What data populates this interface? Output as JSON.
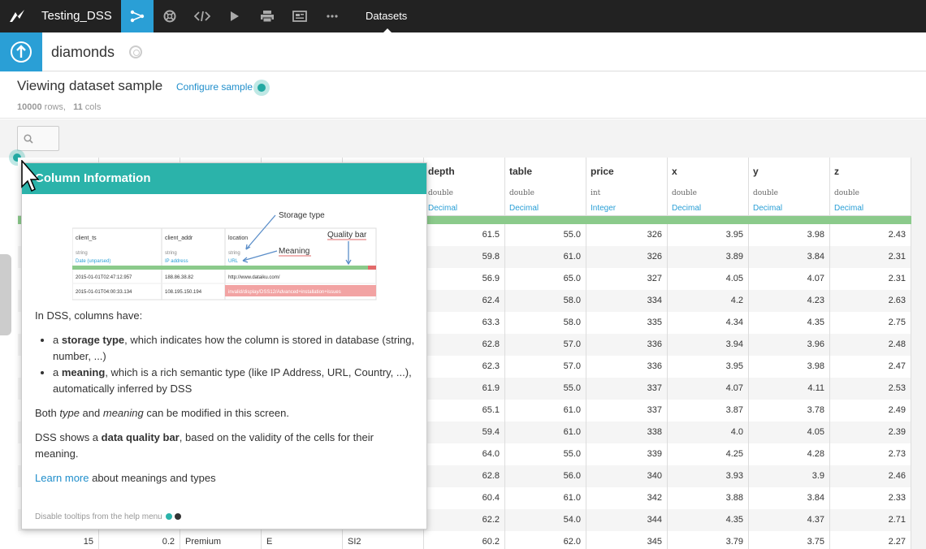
{
  "topnav": {
    "project_name": "Testing_DSS",
    "datasets_label": "Datasets",
    "icons": [
      "flow-icon",
      "lifebuoy-icon",
      "code-icon",
      "play-icon",
      "print-icon",
      "notebook-icon",
      "more-icon"
    ],
    "active_color": "#2a9fd6"
  },
  "dataset": {
    "name": "diamonds"
  },
  "view": {
    "title": "Viewing dataset sample",
    "configure_label": "Configure sample",
    "rows_count": "10000",
    "rows_suffix": " rows,",
    "cols_count": "11",
    "cols_suffix": " cols"
  },
  "columns": [
    {
      "name": "depth",
      "type": "double",
      "meaning": "Decimal"
    },
    {
      "name": "table",
      "type": "double",
      "meaning": "Decimal"
    },
    {
      "name": "price",
      "type": "int",
      "meaning": "Integer"
    },
    {
      "name": "x",
      "type": "double",
      "meaning": "Decimal"
    },
    {
      "name": "y",
      "type": "double",
      "meaning": "Decimal"
    },
    {
      "name": "z",
      "type": "double",
      "meaning": "Decimal"
    }
  ],
  "rows": [
    [
      "61.5",
      "55.0",
      "326",
      "3.95",
      "3.98",
      "2.43"
    ],
    [
      "59.8",
      "61.0",
      "326",
      "3.89",
      "3.84",
      "2.31"
    ],
    [
      "56.9",
      "65.0",
      "327",
      "4.05",
      "4.07",
      "2.31"
    ],
    [
      "62.4",
      "58.0",
      "334",
      "4.2",
      "4.23",
      "2.63"
    ],
    [
      "63.3",
      "58.0",
      "335",
      "4.34",
      "4.35",
      "2.75"
    ],
    [
      "62.8",
      "57.0",
      "336",
      "3.94",
      "3.96",
      "2.48"
    ],
    [
      "62.3",
      "57.0",
      "336",
      "3.95",
      "3.98",
      "2.47"
    ],
    [
      "61.9",
      "55.0",
      "337",
      "4.07",
      "4.11",
      "2.53"
    ],
    [
      "65.1",
      "61.0",
      "337",
      "3.87",
      "3.78",
      "2.49"
    ],
    [
      "59.4",
      "61.0",
      "338",
      "4.0",
      "4.05",
      "2.39"
    ],
    [
      "64.0",
      "55.0",
      "339",
      "4.25",
      "4.28",
      "2.73"
    ],
    [
      "62.8",
      "56.0",
      "340",
      "3.93",
      "3.9",
      "2.46"
    ],
    [
      "60.4",
      "61.0",
      "342",
      "3.88",
      "3.84",
      "2.33"
    ],
    [
      "62.2",
      "54.0",
      "344",
      "4.35",
      "4.37",
      "2.71"
    ]
  ],
  "last_row": {
    "id": "15",
    "carat": "0.2",
    "cut": "Premium",
    "color": "E",
    "clarity": "SI2",
    "depth": "60.2",
    "table": "62.0",
    "price": "345",
    "x": "3.79",
    "y": "3.75",
    "z": "2.27"
  },
  "popover": {
    "title": "Column Information",
    "illustration": {
      "col1": "client_ts",
      "col2": "client_addr",
      "col3": "location",
      "type1": "string",
      "type2": "string",
      "type3": "string",
      "mean1": "Date (unparsed)",
      "mean2": "IP address",
      "mean3": "URL",
      "r1c1": "2015-01-01T02:47:12.957",
      "r1c2": "188.86.38.82",
      "r1c3": "http://www.dataiku.com/",
      "r2c1": "2015-01-01T04:00:33.134",
      "r2c2": "108.195.150.194",
      "r2c3": "invalid/display/DSS12/Advanced+installation+issues",
      "storage_label": "Storage type",
      "meaning_label": "Meaning",
      "quality_label": "Quality bar"
    },
    "intro": "In DSS, columns have:",
    "bullet1_pre": "a ",
    "bullet1_bold": "storage type",
    "bullet1_post": ", which indicates how the column is stored in database (string, number, ...)",
    "bullet2_pre": "a ",
    "bullet2_bold": "meaning",
    "bullet2_post": ", which is a rich semantic type (like IP Address, URL, Country, ...), automatically inferred by DSS",
    "both_pre": "Both ",
    "both_type": "type",
    "both_mid": " and ",
    "both_meaning": "meaning",
    "both_post": " can be modified in this screen.",
    "dq_pre": "DSS shows a ",
    "dq_bold": "data quality bar",
    "dq_post": ", based on the validity of the cells for their meaning.",
    "learn_link": "Learn more",
    "learn_post": " about meanings and types",
    "footer": "Disable tooltips from the help menu"
  }
}
